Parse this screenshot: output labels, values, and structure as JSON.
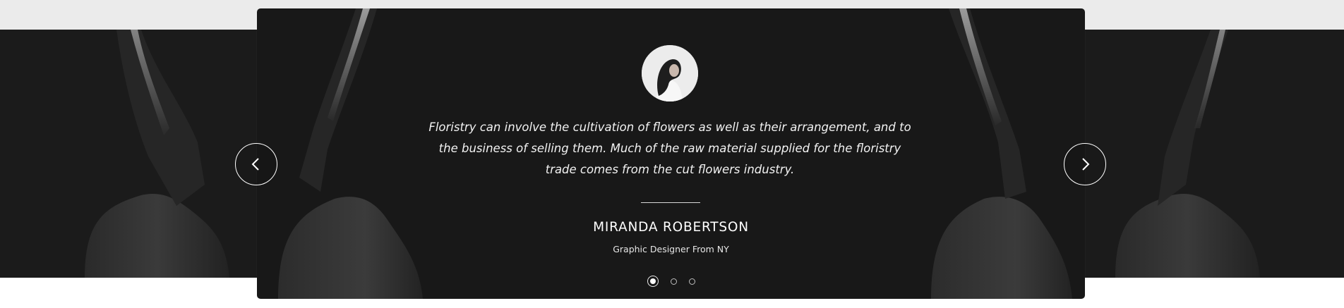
{
  "testimonial": {
    "quote": "Floristry can involve the cultivation of flowers as well as their arrangement, and to the business of selling them. Much of the raw material supplied for the floristry trade comes from the cut flowers industry.",
    "name": "MIRANDA ROBERTSON",
    "role": "Graphic Designer From NY"
  },
  "slider": {
    "total_slides": 3,
    "active_slide": 1,
    "prev_icon": "chevron-left-icon",
    "next_icon": "chevron-right-icon"
  },
  "colors": {
    "card_bg": "#181818",
    "text": "#ffffff",
    "page_band": "#ebebeb"
  }
}
